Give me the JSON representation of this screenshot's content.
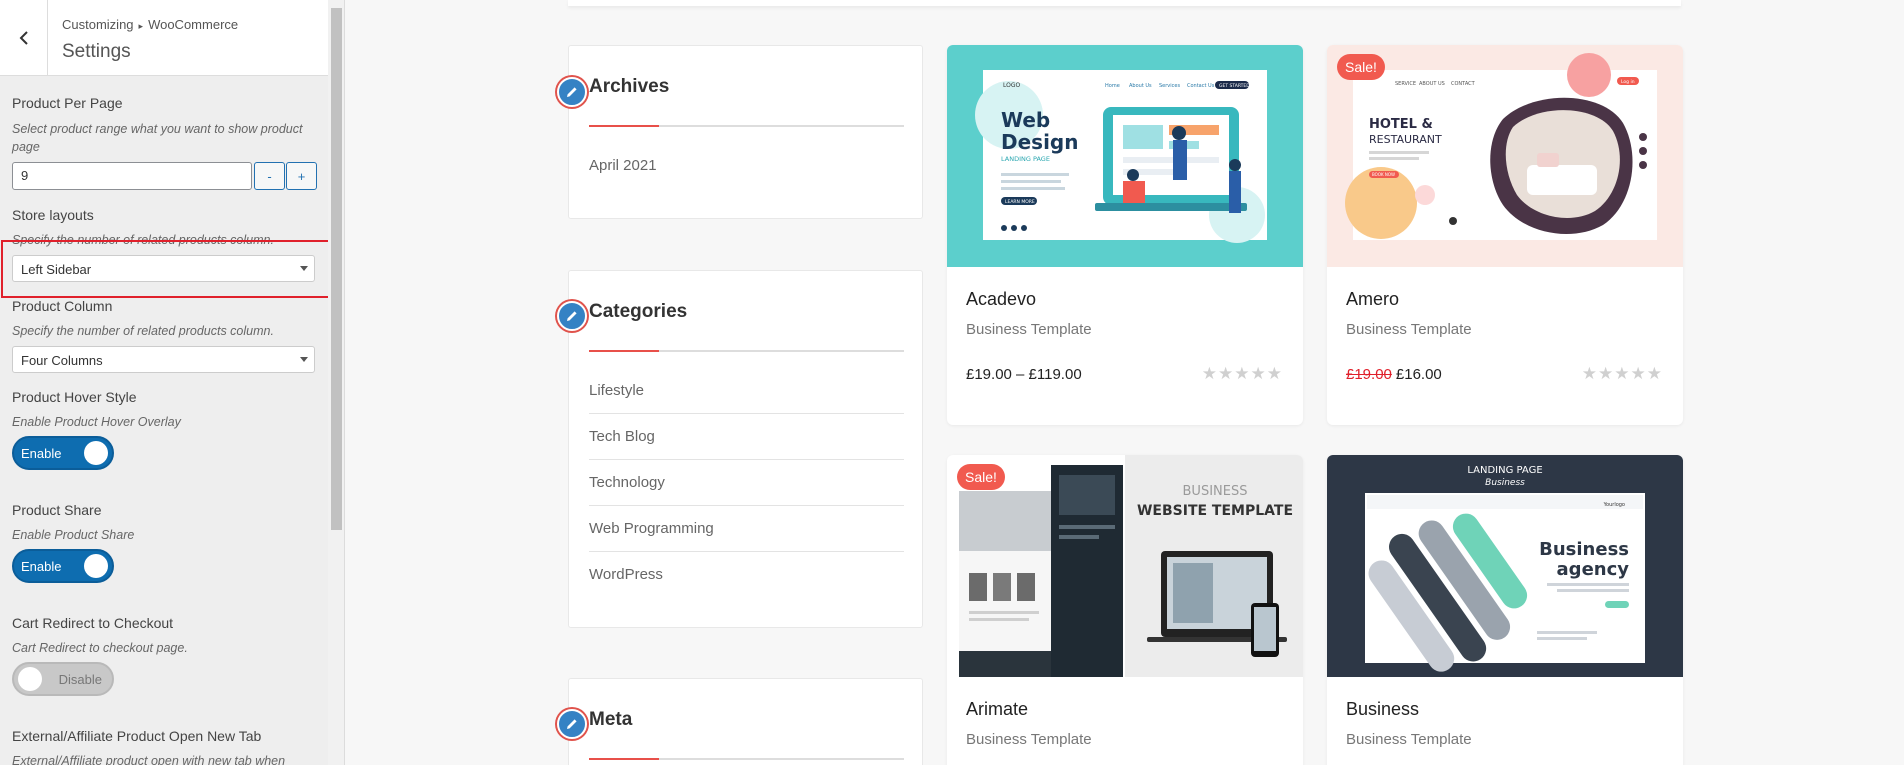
{
  "sidebar": {
    "breadcrumb_root": "Customizing",
    "breadcrumb_section": "WooCommerce",
    "title": "Settings",
    "per_page": {
      "label": "Product Per Page",
      "desc": "Select product range what you want to show product page",
      "value": "9",
      "minus": "-",
      "plus": "+"
    },
    "store_layouts": {
      "label": "Store layouts",
      "desc": "Specify the number of related products column.",
      "value": "Left Sidebar"
    },
    "product_column": {
      "label": "Product Column",
      "desc": "Specify the number of related products column.",
      "value": "Four Columns"
    },
    "hover_style": {
      "label": "Product Hover Style",
      "desc": "Enable Product Hover Overlay",
      "toggle": "Enable"
    },
    "product_share": {
      "label": "Product Share",
      "desc": "Enable Product Share",
      "toggle": "Enable"
    },
    "cart_redirect": {
      "label": "Cart Redirect to Checkout",
      "desc": "Cart Redirect to checkout page.",
      "toggle": "Disable"
    },
    "external_affiliate": {
      "label": "External/Affiliate Product Open New Tab",
      "desc": "External/Affiliate product open with new tab when"
    }
  },
  "widgets": {
    "archives": {
      "title": "Archives",
      "items": [
        "April 2021"
      ]
    },
    "categories": {
      "title": "Categories",
      "items": [
        "Lifestyle",
        "Tech Blog",
        "Technology",
        "Web Programming",
        "WordPress"
      ]
    },
    "meta": {
      "title": "Meta"
    }
  },
  "products": [
    {
      "name": "Acadevo",
      "category": "Business Template",
      "price": "£19.00 – £119.00",
      "sale": "",
      "image": {
        "logo": "LOGO",
        "nav": [
          "Home",
          "About Us",
          "Services",
          "Contact Us"
        ],
        "cta": "GET STARTED",
        "headline1": "Web",
        "headline2": "Design",
        "sub": "LANDING PAGE",
        "btn": "LEARN MORE"
      }
    },
    {
      "name": "Amero",
      "category": "Business Template",
      "price_old": "£19.00",
      "price": "£16.00",
      "sale": "Sale!",
      "image": {
        "nav": [
          "SERVICE",
          "ABOUT US",
          "CONTACT"
        ],
        "login": "Log in",
        "headline1": "HOTEL &",
        "headline2": "RESTAURANT",
        "btn": "BOOK NOW"
      }
    },
    {
      "name": "Arimate",
      "category": "Business Template",
      "sale": "Sale!",
      "image": {
        "line1": "BUSINESS",
        "line2": "WEBSITE TEMPLATE"
      }
    },
    {
      "name": "Business",
      "category": "Business Template",
      "sale": "",
      "image": {
        "top1": "LANDING PAGE",
        "top2": "Business",
        "headline1": "Business",
        "headline2": "agency",
        "logo": "Yourlogo"
      }
    }
  ],
  "stars": "★★★★★",
  "colors": {
    "accent": "#0e6db0",
    "sale": "#f15a4f",
    "highlight": "#e0202b",
    "teal": "#5ccfcc"
  }
}
